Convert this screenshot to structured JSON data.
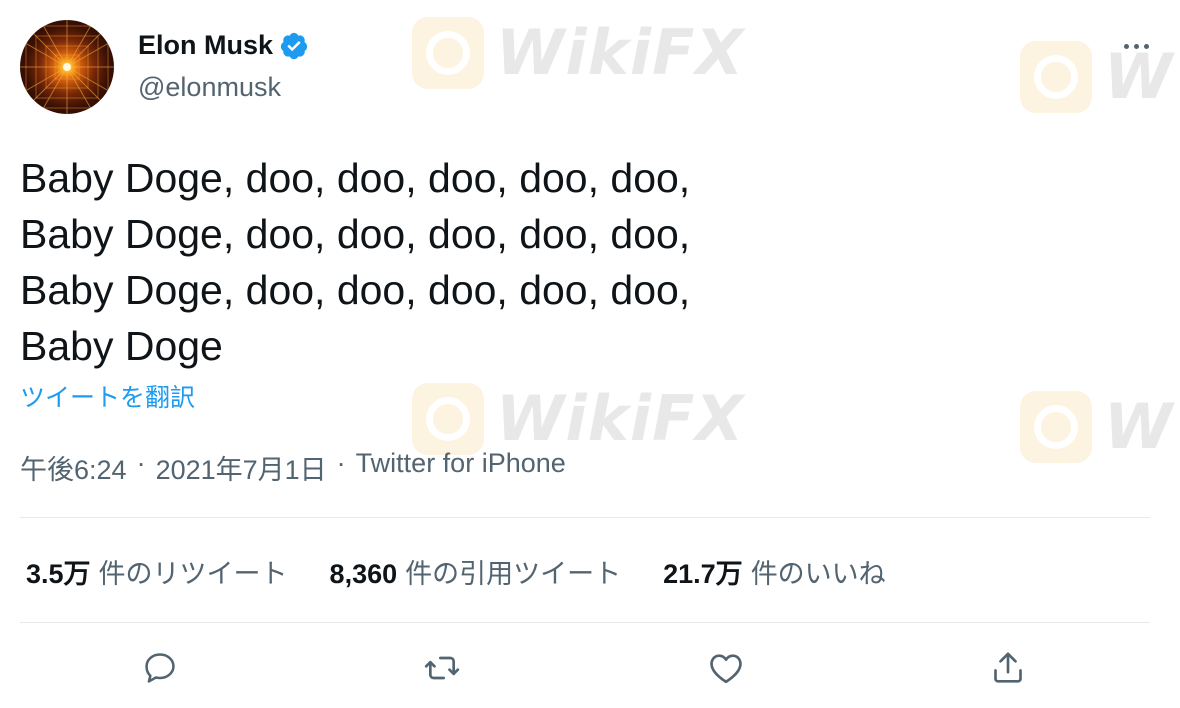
{
  "user": {
    "display_name": "Elon Musk",
    "handle": "@elonmusk",
    "verified": true
  },
  "tweet": {
    "text": "Baby Doge, doo, doo, doo, doo, doo,\nBaby Doge, doo, doo, doo, doo, doo,\nBaby Doge, doo, doo, doo, doo, doo,\nBaby Doge",
    "translate_label": "ツイートを翻訳",
    "time": "午後6:24",
    "date": "2021年7月1日",
    "source": "Twitter for iPhone",
    "separator": "·"
  },
  "stats": {
    "retweets": {
      "count": "3.5万",
      "label": "件のリツイート"
    },
    "quotes": {
      "count": "8,360",
      "label": "件の引用ツイート"
    },
    "likes": {
      "count": "21.7万",
      "label": "件のいいね"
    }
  },
  "watermark": {
    "text_full": "WikiFX",
    "text_partial": "W"
  },
  "colors": {
    "accent": "#1d9bf0",
    "text_primary": "#0f1419",
    "text_secondary": "#536471",
    "divider": "#e6e9eb",
    "verified_badge": "#1d9bf0",
    "watermark_logo": "#e9a81c"
  },
  "icons": {
    "verified": "verified-badge-icon",
    "more": "more-icon",
    "reply": "reply-icon",
    "retweet": "retweet-icon",
    "like": "like-icon",
    "share": "share-icon"
  }
}
